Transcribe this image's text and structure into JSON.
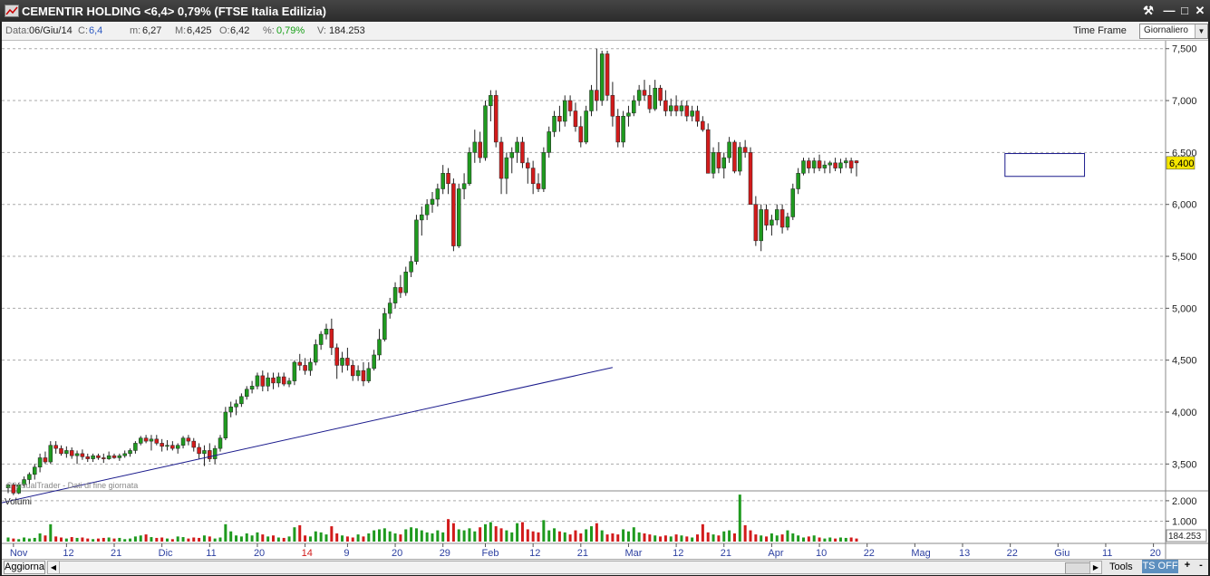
{
  "window": {
    "title": "CEMENTIR HOLDING <6,4> 0,79%  (FTSE Italia Edilizia)"
  },
  "info": {
    "data_label": "Data:",
    "data_value": "06/Giu/14",
    "c_label": "C:",
    "c_value": "6,4",
    "m_label": "m:",
    "m_value": "6,27",
    "M_label": "M:",
    "M_value": "6,425",
    "o_label": "O:",
    "o_value": "6,42",
    "pct_label": "%:",
    "pct_value": "0,79%",
    "v_label": "V:",
    "v_value": "184.253",
    "timeframe_label": "Time Frame",
    "timeframe_value": "Giornaliero"
  },
  "colors": {
    "up": "#1f9a1f",
    "down": "#d21b1b",
    "trendline": "#1a1a8c",
    "box": "#1a1a8c",
    "price_tag": "#f5e600"
  },
  "watermark": "© VisualTrader - Dati di fine giornata",
  "volume_label": "Volumi",
  "last_price_tag": "6,400",
  "last_volume_tag": "184.253",
  "bottom": {
    "aggiorna": "Aggiorna",
    "tools": "Tools",
    "tsoff": "TS OFF",
    "plus": "+",
    "minus": "-"
  },
  "chart_data": {
    "type": "candlestick",
    "price_axis": {
      "min": 3.25,
      "max": 7.55,
      "ticks": [
        3.5,
        4.0,
        4.5,
        5.0,
        5.5,
        6.0,
        6.5,
        7.0,
        7.5
      ],
      "tick_labels": [
        "3,500",
        "4,000",
        "4,500",
        "5,000",
        "5,500",
        "6,000",
        "6,500",
        "7,000",
        "7,500"
      ],
      "grid": "dashed"
    },
    "volume_axis": {
      "ticks": [
        1000000,
        2000000
      ],
      "tick_labels": [
        "1.000",
        "2.000"
      ]
    },
    "x_axis": {
      "labels": [
        "Nov",
        "12",
        "21",
        "Dic",
        "11",
        "20",
        "14",
        "9",
        "20",
        "29",
        "Feb",
        "12",
        "21",
        "Mar",
        "12",
        "21",
        "Apr",
        "10",
        "22",
        "Mag",
        "13",
        "22",
        "Giu",
        "11",
        "20"
      ],
      "label_positions": [
        1,
        11,
        20,
        29,
        38,
        47,
        56,
        64,
        73,
        82,
        90,
        99,
        108,
        117,
        126,
        135,
        144,
        153,
        162,
        171,
        180,
        189,
        198,
        207,
        216
      ],
      "highlight_label_index": 6
    },
    "candles": [
      [
        3.27,
        3.31,
        3.22,
        3.3
      ],
      [
        3.3,
        3.32,
        3.2,
        3.22
      ],
      [
        3.22,
        3.32,
        3.21,
        3.3
      ],
      [
        3.3,
        3.38,
        3.28,
        3.35
      ],
      [
        3.35,
        3.42,
        3.3,
        3.4
      ],
      [
        3.4,
        3.5,
        3.35,
        3.47
      ],
      [
        3.47,
        3.6,
        3.42,
        3.56
      ],
      [
        3.56,
        3.62,
        3.5,
        3.52
      ],
      [
        3.52,
        3.72,
        3.5,
        3.68
      ],
      [
        3.68,
        3.72,
        3.6,
        3.65
      ],
      [
        3.65,
        3.68,
        3.58,
        3.6
      ],
      [
        3.6,
        3.67,
        3.56,
        3.63
      ],
      [
        3.63,
        3.66,
        3.55,
        3.58
      ],
      [
        3.58,
        3.63,
        3.5,
        3.6
      ],
      [
        3.6,
        3.64,
        3.54,
        3.57
      ],
      [
        3.57,
        3.6,
        3.52,
        3.55
      ],
      [
        3.55,
        3.6,
        3.52,
        3.58
      ],
      [
        3.58,
        3.6,
        3.54,
        3.56
      ],
      [
        3.56,
        3.6,
        3.51,
        3.55
      ],
      [
        3.55,
        3.62,
        3.54,
        3.58
      ],
      [
        3.58,
        3.6,
        3.55,
        3.56
      ],
      [
        3.56,
        3.6,
        3.53,
        3.58
      ],
      [
        3.58,
        3.63,
        3.56,
        3.6
      ],
      [
        3.6,
        3.65,
        3.57,
        3.63
      ],
      [
        3.63,
        3.72,
        3.6,
        3.7
      ],
      [
        3.7,
        3.77,
        3.68,
        3.75
      ],
      [
        3.75,
        3.78,
        3.7,
        3.72
      ],
      [
        3.72,
        3.78,
        3.63,
        3.74
      ],
      [
        3.74,
        3.78,
        3.68,
        3.7
      ],
      [
        3.7,
        3.74,
        3.62,
        3.67
      ],
      [
        3.67,
        3.73,
        3.63,
        3.68
      ],
      [
        3.68,
        3.72,
        3.63,
        3.65
      ],
      [
        3.65,
        3.7,
        3.6,
        3.68
      ],
      [
        3.68,
        3.77,
        3.65,
        3.75
      ],
      [
        3.75,
        3.78,
        3.68,
        3.72
      ],
      [
        3.72,
        3.75,
        3.62,
        3.66
      ],
      [
        3.66,
        3.7,
        3.55,
        3.6
      ],
      [
        3.6,
        3.68,
        3.48,
        3.63
      ],
      [
        3.63,
        3.7,
        3.52,
        3.55
      ],
      [
        3.55,
        3.68,
        3.5,
        3.65
      ],
      [
        3.65,
        3.78,
        3.62,
        3.75
      ],
      [
        3.75,
        4.05,
        3.73,
        4.0
      ],
      [
        4.0,
        4.1,
        3.95,
        4.05
      ],
      [
        4.05,
        4.12,
        3.97,
        4.08
      ],
      [
        4.08,
        4.18,
        4.05,
        4.15
      ],
      [
        4.15,
        4.25,
        4.12,
        4.22
      ],
      [
        4.22,
        4.3,
        4.18,
        4.25
      ],
      [
        4.25,
        4.38,
        4.22,
        4.35
      ],
      [
        4.35,
        4.4,
        4.2,
        4.25
      ],
      [
        4.25,
        4.38,
        4.2,
        4.33
      ],
      [
        4.33,
        4.38,
        4.22,
        4.28
      ],
      [
        4.28,
        4.38,
        4.24,
        4.34
      ],
      [
        4.34,
        4.38,
        4.25,
        4.27
      ],
      [
        4.27,
        4.33,
        4.24,
        4.3
      ],
      [
        4.3,
        4.5,
        4.26,
        4.48
      ],
      [
        4.48,
        4.56,
        4.4,
        4.45
      ],
      [
        4.45,
        4.52,
        4.36,
        4.4
      ],
      [
        4.4,
        4.52,
        4.35,
        4.48
      ],
      [
        4.48,
        4.7,
        4.45,
        4.65
      ],
      [
        4.65,
        4.78,
        4.6,
        4.75
      ],
      [
        4.75,
        4.85,
        4.7,
        4.8
      ],
      [
        4.8,
        4.9,
        4.55,
        4.62
      ],
      [
        4.62,
        4.66,
        4.32,
        4.45
      ],
      [
        4.45,
        4.58,
        4.38,
        4.52
      ],
      [
        4.52,
        4.62,
        4.4,
        4.45
      ],
      [
        4.45,
        4.5,
        4.3,
        4.35
      ],
      [
        4.35,
        4.45,
        4.3,
        4.4
      ],
      [
        4.4,
        4.48,
        4.25,
        4.3
      ],
      [
        4.3,
        4.48,
        4.28,
        4.42
      ],
      [
        4.42,
        4.6,
        4.4,
        4.55
      ],
      [
        4.55,
        4.8,
        4.5,
        4.7
      ],
      [
        4.7,
        5.0,
        4.68,
        4.95
      ],
      [
        4.95,
        5.1,
        4.9,
        5.05
      ],
      [
        5.05,
        5.25,
        5.0,
        5.2
      ],
      [
        5.2,
        5.32,
        5.1,
        5.15
      ],
      [
        5.15,
        5.4,
        5.12,
        5.35
      ],
      [
        5.35,
        5.5,
        5.3,
        5.45
      ],
      [
        5.45,
        5.9,
        5.42,
        5.85
      ],
      [
        5.85,
        5.98,
        5.7,
        5.9
      ],
      [
        5.9,
        6.05,
        5.85,
        6.0
      ],
      [
        6.0,
        6.12,
        5.92,
        6.05
      ],
      [
        6.05,
        6.2,
        5.98,
        6.15
      ],
      [
        6.15,
        6.38,
        6.1,
        6.3
      ],
      [
        6.3,
        6.35,
        6.1,
        6.2
      ],
      [
        6.2,
        6.25,
        5.55,
        5.6
      ],
      [
        5.6,
        6.2,
        5.58,
        6.15
      ],
      [
        6.15,
        6.3,
        6.05,
        6.2
      ],
      [
        6.2,
        6.55,
        6.18,
        6.5
      ],
      [
        6.5,
        6.72,
        6.4,
        6.6
      ],
      [
        6.6,
        6.7,
        6.4,
        6.45
      ],
      [
        6.45,
        7.0,
        6.42,
        6.95
      ],
      [
        6.95,
        7.1,
        6.8,
        7.05
      ],
      [
        7.05,
        7.1,
        6.55,
        6.6
      ],
      [
        6.6,
        6.65,
        6.1,
        6.25
      ],
      [
        6.25,
        6.5,
        6.1,
        6.45
      ],
      [
        6.45,
        6.55,
        6.3,
        6.5
      ],
      [
        6.5,
        6.65,
        6.4,
        6.6
      ],
      [
        6.6,
        6.65,
        6.35,
        6.4
      ],
      [
        6.4,
        6.45,
        6.2,
        6.35
      ],
      [
        6.35,
        6.42,
        6.1,
        6.2
      ],
      [
        6.2,
        6.3,
        6.12,
        6.15
      ],
      [
        6.15,
        6.55,
        6.12,
        6.5
      ],
      [
        6.5,
        6.75,
        6.45,
        6.7
      ],
      [
        6.7,
        6.9,
        6.65,
        6.85
      ],
      [
        6.85,
        6.95,
        6.7,
        6.8
      ],
      [
        6.8,
        7.05,
        6.75,
        7.0
      ],
      [
        7.0,
        7.05,
        6.85,
        6.9
      ],
      [
        6.9,
        6.98,
        6.7,
        6.75
      ],
      [
        6.75,
        6.85,
        6.55,
        6.6
      ],
      [
        6.6,
        6.95,
        6.58,
        6.9
      ],
      [
        6.9,
        7.15,
        6.85,
        7.1
      ],
      [
        7.1,
        7.5,
        6.9,
        7.0
      ],
      [
        7.0,
        7.48,
        6.95,
        7.45
      ],
      [
        7.45,
        7.48,
        7.0,
        7.05
      ],
      [
        7.05,
        7.18,
        6.75,
        6.85
      ],
      [
        6.85,
        6.92,
        6.55,
        6.6
      ],
      [
        6.6,
        6.9,
        6.55,
        6.85
      ],
      [
        6.85,
        6.95,
        6.75,
        6.88
      ],
      [
        6.88,
        7.05,
        6.85,
        7.0
      ],
      [
        7.0,
        7.15,
        6.95,
        7.1
      ],
      [
        7.1,
        7.2,
        7.0,
        7.05
      ],
      [
        7.05,
        7.15,
        6.88,
        6.92
      ],
      [
        6.92,
        7.2,
        6.9,
        7.12
      ],
      [
        7.12,
        7.15,
        6.95,
        7.0
      ],
      [
        7.0,
        7.1,
        6.85,
        6.9
      ],
      [
        6.9,
        7.02,
        6.85,
        6.95
      ],
      [
        6.95,
        7.05,
        6.85,
        6.9
      ],
      [
        6.9,
        7.0,
        6.85,
        6.95
      ],
      [
        6.95,
        7.0,
        6.8,
        6.85
      ],
      [
        6.85,
        6.95,
        6.8,
        6.9
      ],
      [
        6.9,
        6.95,
        6.75,
        6.8
      ],
      [
        6.8,
        6.85,
        6.7,
        6.72
      ],
      [
        6.72,
        6.78,
        6.3,
        6.3
      ],
      [
        6.3,
        6.55,
        6.25,
        6.5
      ],
      [
        6.5,
        6.6,
        6.3,
        6.35
      ],
      [
        6.35,
        6.5,
        6.25,
        6.45
      ],
      [
        6.45,
        6.65,
        6.4,
        6.6
      ],
      [
        6.6,
        6.62,
        6.3,
        6.32
      ],
      [
        6.32,
        6.6,
        6.28,
        6.55
      ],
      [
        6.55,
        6.62,
        6.45,
        6.5
      ],
      [
        6.5,
        6.55,
        6.0,
        6.0
      ],
      [
        6.0,
        6.08,
        5.6,
        5.65
      ],
      [
        5.65,
        6.0,
        5.55,
        5.95
      ],
      [
        5.95,
        6.0,
        5.75,
        5.8
      ],
      [
        5.8,
        5.9,
        5.7,
        5.85
      ],
      [
        5.85,
        6.0,
        5.8,
        5.95
      ],
      [
        5.95,
        6.0,
        5.72,
        5.78
      ],
      [
        5.78,
        5.92,
        5.75,
        5.88
      ],
      [
        5.88,
        6.2,
        5.85,
        6.15
      ],
      [
        6.15,
        6.35,
        6.1,
        6.3
      ],
      [
        6.3,
        6.45,
        6.28,
        6.42
      ],
      [
        6.42,
        6.45,
        6.3,
        6.35
      ],
      [
        6.35,
        6.45,
        6.3,
        6.42
      ],
      [
        6.42,
        6.48,
        6.32,
        6.35
      ],
      [
        6.35,
        6.42,
        6.3,
        6.38
      ],
      [
        6.38,
        6.42,
        6.3,
        6.4
      ],
      [
        6.4,
        6.45,
        6.32,
        6.35
      ],
      [
        6.35,
        6.44,
        6.3,
        6.4
      ],
      [
        6.4,
        6.45,
        6.35,
        6.42
      ],
      [
        6.42,
        6.45,
        6.3,
        6.35
      ],
      [
        6.42,
        6.425,
        6.27,
        6.4
      ]
    ],
    "volumes": [
      0.2,
      0.15,
      0.12,
      0.2,
      0.15,
      0.18,
      0.4,
      0.3,
      0.85,
      0.25,
      0.2,
      0.15,
      0.22,
      0.18,
      0.2,
      0.15,
      0.12,
      0.15,
      0.18,
      0.2,
      0.15,
      0.18,
      0.12,
      0.15,
      0.25,
      0.3,
      0.35,
      0.22,
      0.18,
      0.2,
      0.15,
      0.12,
      0.25,
      0.22,
      0.15,
      0.2,
      0.18,
      0.3,
      0.25,
      0.15,
      0.2,
      0.85,
      0.5,
      0.3,
      0.25,
      0.4,
      0.3,
      0.45,
      0.35,
      0.25,
      0.3,
      0.2,
      0.18,
      0.25,
      0.7,
      0.8,
      0.3,
      0.25,
      0.5,
      0.45,
      0.35,
      0.75,
      0.4,
      0.3,
      0.25,
      0.2,
      0.35,
      0.25,
      0.4,
      0.55,
      0.6,
      0.65,
      0.5,
      0.4,
      0.35,
      0.6,
      0.7,
      0.65,
      0.55,
      0.45,
      0.4,
      0.55,
      0.45,
      1.1,
      0.9,
      0.6,
      0.55,
      0.65,
      0.5,
      0.7,
      0.85,
      0.95,
      0.75,
      0.65,
      0.55,
      0.45,
      0.9,
      0.95,
      0.6,
      0.5,
      0.45,
      1.05,
      0.55,
      0.65,
      0.5,
      0.45,
      0.35,
      0.55,
      0.4,
      0.6,
      0.75,
      0.9,
      0.55,
      0.35,
      0.4,
      0.35,
      0.6,
      0.5,
      0.7,
      0.45,
      0.4,
      0.35,
      0.3,
      0.25,
      0.3,
      0.25,
      0.35,
      0.3,
      0.25,
      0.2,
      0.35,
      0.85,
      0.45,
      0.35,
      0.3,
      0.5,
      0.55,
      0.4,
      2.3,
      0.8,
      0.55,
      0.35,
      0.3,
      0.25,
      0.4,
      0.3,
      0.35,
      0.55,
      0.4,
      0.3,
      0.2,
      0.25,
      0.3,
      0.2,
      0.15,
      0.2,
      0.15,
      0.2,
      0.18,
      0.2,
      0.15
    ],
    "trendline": {
      "from_index": -8,
      "from_price": 3.05,
      "to_index": 114,
      "to_price": 4.43
    },
    "consolidation_box": {
      "from_index": 188,
      "to_index": 203,
      "price_low": 6.27,
      "price_high": 6.49
    }
  }
}
